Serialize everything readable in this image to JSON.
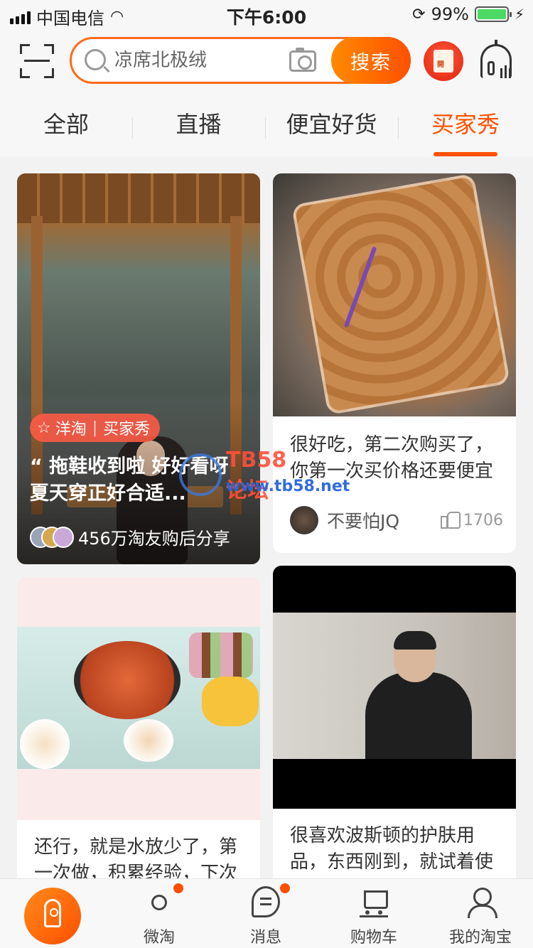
{
  "status_bar": {
    "carrier": "中国电信",
    "time": "下午6:00",
    "battery_pct": "99%",
    "battery_level": 0.99
  },
  "header": {
    "search_placeholder": "凉席北极绒",
    "search_button": "搜索",
    "icons": [
      "scan-icon",
      "magnifier-icon",
      "camera-icon",
      "red-packet-icon",
      "robot-icon"
    ]
  },
  "tabs": [
    {
      "label": "全部",
      "active": false
    },
    {
      "label": "直播",
      "active": false
    },
    {
      "label": "便宜好货",
      "active": false
    },
    {
      "label": "买家秀",
      "active": true
    }
  ],
  "colors": {
    "accent": "#ff5000",
    "accent_light": "#ff8a00"
  },
  "feed": {
    "featured": {
      "badge_left": "洋淘",
      "badge_right": "买家秀",
      "title": "“ 拖鞋收到啦 好好看呀 夏天穿正好合适...",
      "share_text": "456万淘友购后分享"
    },
    "post1": {
      "caption": "很好吃，第二次购买了，你第一次买价格还要便宜",
      "user": "不要怕JQ",
      "likes": "1706"
    },
    "post2": {
      "caption": "还行，就是水放少了，第一次做，积累经验，下次"
    },
    "post3": {
      "caption": "很喜欢波斯顿的护肤用品，东西刚到，就试着使用"
    }
  },
  "watermark": {
    "title": "TB58论坛",
    "url": "www.tb58.net"
  },
  "bottom_nav": [
    {
      "label": "微淘",
      "has_dot": true
    },
    {
      "label": "消息",
      "has_dot": true
    },
    {
      "label": "购物车",
      "has_dot": false
    },
    {
      "label": "我的淘宝",
      "has_dot": false
    }
  ]
}
